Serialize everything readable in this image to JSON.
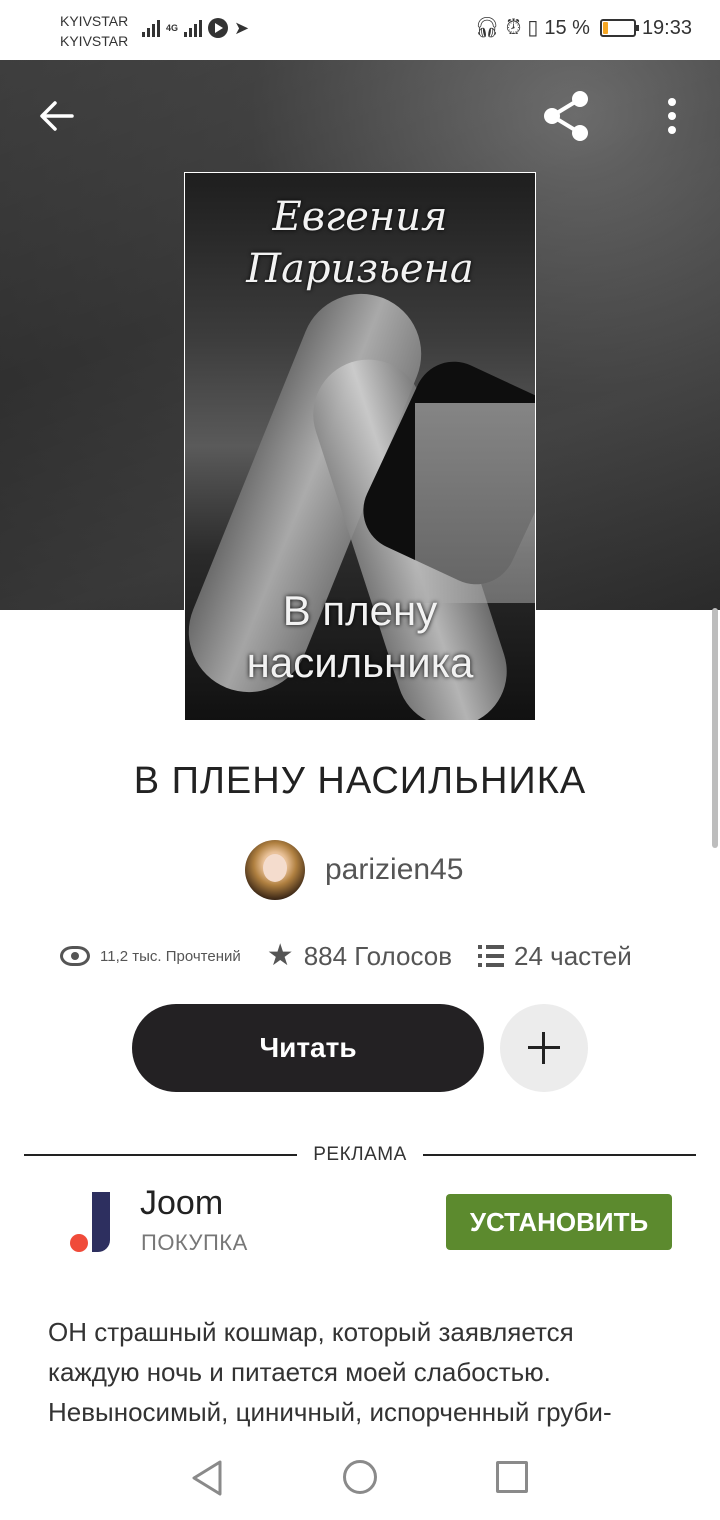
{
  "status_bar": {
    "carrier_1": "KYIVSTAR",
    "carrier_2": "KYIVSTAR",
    "network_type": "4G",
    "battery_percent": "15 %",
    "battery_level": 0.15,
    "time": "19:33",
    "icons": [
      "signal-icon",
      "signal-4g-icon",
      "play-icon",
      "telegram-icon",
      "headphones-icon",
      "alarm-icon",
      "vibrate-icon",
      "battery-icon"
    ]
  },
  "header": {
    "back_icon": "arrow-left-icon",
    "share_icon": "share-icon",
    "more_icon": "more-vertical-icon"
  },
  "cover": {
    "author_line_1": "Евгения",
    "author_line_2": "Паризьена",
    "title_line_1": "В плену",
    "title_line_2": "насильника"
  },
  "book": {
    "title": "В  ПЛЕНУ  НАСИЛЬНИКА",
    "author": "parizien45",
    "stats": {
      "views": "11,2 тыс. Прочтений",
      "votes": "884 Голосов",
      "parts": "24 частей"
    },
    "read_button": "Читать"
  },
  "ad": {
    "label": "РЕКЛАМА",
    "app_name": "Joom",
    "category": "ПОКУПКА",
    "install_button": "УСТАНОВИТЬ",
    "colors": {
      "install": "#5c8a2e",
      "logo_bar": "#2d2f5f",
      "logo_dot": "#f04b3a"
    }
  },
  "description": {
    "line_1": "ОН страшный кошмар, который заявляется",
    "line_2": "каждую ночь и питается моей слабостью.",
    "line_3": "Невыносимый, циничный, испорченный груби-"
  },
  "nav": {
    "icons": [
      "nav-back-icon",
      "nav-home-icon",
      "nav-recent-icon"
    ]
  }
}
